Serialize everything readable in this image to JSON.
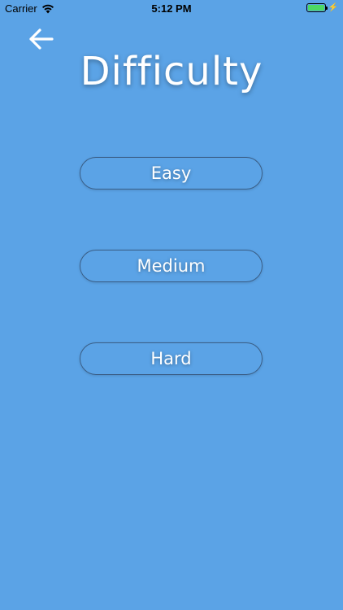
{
  "status_bar": {
    "carrier": "Carrier",
    "time": "5:12 PM",
    "battery_color": "#4cd964",
    "wifi_icon": "wifi-icon",
    "battery_icon": "battery-icon",
    "charging_icon": "bolt-icon"
  },
  "nav": {
    "back_icon": "arrow-left-icon"
  },
  "title": "Difficulty",
  "options": {
    "easy": "Easy",
    "medium": "Medium",
    "hard": "Hard"
  },
  "colors": {
    "background": "#5ba3e6",
    "text": "#ffffff",
    "button_border": "#3a5e86"
  }
}
